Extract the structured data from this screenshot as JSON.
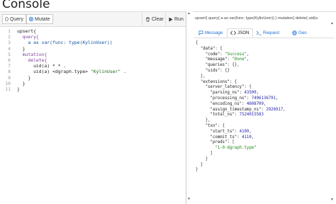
{
  "page": {
    "title": "Console"
  },
  "toolbar": {
    "query_label": "Query",
    "mutate_label": "Mutate",
    "mode_selected": "Mutate",
    "clear_label": "Clear",
    "run_label": "Run"
  },
  "editor": {
    "line_numbers": [
      "1",
      "2",
      "3",
      "4",
      "5",
      "6",
      "7",
      "8",
      "9",
      "10",
      "11"
    ],
    "lines": [
      {
        "parts": [
          {
            "t": "upsert{",
            "c": ""
          }
        ]
      },
      {
        "parts": [
          {
            "t": "  query{",
            "c": "kw"
          }
        ]
      },
      {
        "parts": [
          {
            "t": "    a as var(func: type(KylinUser))",
            "c": "fn"
          }
        ]
      },
      {
        "parts": [
          {
            "t": "  }",
            "c": ""
          }
        ]
      },
      {
        "parts": [
          {
            "t": "  mutation{",
            "c": "kw"
          }
        ]
      },
      {
        "parts": [
          {
            "t": "    delete{",
            "c": "kw"
          }
        ]
      },
      {
        "parts": [
          {
            "t": "      uid(a) * * .",
            "c": ""
          }
        ]
      },
      {
        "parts": [
          {
            "t": "      uid(a) <dgraph.type> ",
            "c": ""
          },
          {
            "t": "\"KylinUser\"",
            "c": "str"
          },
          {
            "t": " .",
            "c": ""
          }
        ]
      },
      {
        "parts": [
          {
            "t": "    }",
            "c": ""
          }
        ]
      },
      {
        "parts": [
          {
            "t": "  }",
            "c": ""
          }
        ]
      },
      {
        "parts": [
          {
            "t": "}",
            "c": ""
          }
        ]
      }
    ]
  },
  "query_summary": "upsert{ query{ a as var(func: type(KylinUser)) } mutation{ delete{ uid(a",
  "tabs": [
    {
      "label": "Message",
      "icon": "message-icon",
      "active": false
    },
    {
      "label": "JSON",
      "icon": "code-icon",
      "active": true
    },
    {
      "label": "Request",
      "icon": "terminal-icon",
      "active": false
    },
    {
      "label": "Geo",
      "icon": "globe-icon",
      "active": false
    }
  ],
  "json_lines": [
    [
      {
        "t": "{",
        "c": ""
      }
    ],
    [
      {
        "t": "  \"data\"",
        "c": "jk"
      },
      {
        "t": ": {",
        "c": ""
      }
    ],
    [
      {
        "t": "    \"code\"",
        "c": "jk"
      },
      {
        "t": ": ",
        "c": ""
      },
      {
        "t": "\"Success\"",
        "c": "js"
      },
      {
        "t": ",",
        "c": ""
      }
    ],
    [
      {
        "t": "    \"message\"",
        "c": "jk"
      },
      {
        "t": ": ",
        "c": ""
      },
      {
        "t": "\"Done\"",
        "c": "js"
      },
      {
        "t": ",",
        "c": ""
      }
    ],
    [
      {
        "t": "    \"queries\"",
        "c": "jk"
      },
      {
        "t": ": {},",
        "c": ""
      }
    ],
    [
      {
        "t": "    \"uids\"",
        "c": "jk"
      },
      {
        "t": ": {}",
        "c": ""
      }
    ],
    [
      {
        "t": "  },",
        "c": ""
      }
    ],
    [
      {
        "t": "  \"extensions\"",
        "c": "jk"
      },
      {
        "t": ": {",
        "c": ""
      }
    ],
    [
      {
        "t": "    \"server_latency\"",
        "c": "jk"
      },
      {
        "t": ": {",
        "c": ""
      }
    ],
    [
      {
        "t": "      \"parsing_ns\"",
        "c": "jk"
      },
      {
        "t": ": ",
        "c": ""
      },
      {
        "t": "43500",
        "c": "jn"
      },
      {
        "t": ",",
        "c": ""
      }
    ],
    [
      {
        "t": "      \"processing_ns\"",
        "c": "jk"
      },
      {
        "t": ": ",
        "c": ""
      },
      {
        "t": "7496136791",
        "c": "jn"
      },
      {
        "t": ",",
        "c": ""
      }
    ],
    [
      {
        "t": "      \"encoding_ns\"",
        "c": "jk"
      },
      {
        "t": ": ",
        "c": ""
      },
      {
        "t": "4608709",
        "c": "jn"
      },
      {
        "t": ",",
        "c": ""
      }
    ],
    [
      {
        "t": "      \"assign_timestamp_ns\"",
        "c": "jk"
      },
      {
        "t": ": ",
        "c": ""
      },
      {
        "t": "2926917",
        "c": "jn"
      },
      {
        "t": ",",
        "c": ""
      }
    ],
    [
      {
        "t": "      \"total_ns\"",
        "c": "jk"
      },
      {
        "t": ": ",
        "c": ""
      },
      {
        "t": "7524015583",
        "c": "jn"
      }
    ],
    [
      {
        "t": "    },",
        "c": ""
      }
    ],
    [
      {
        "t": "    \"txn\"",
        "c": "jk"
      },
      {
        "t": ": {",
        "c": ""
      }
    ],
    [
      {
        "t": "      \"start_ts\"",
        "c": "jk"
      },
      {
        "t": ": ",
        "c": ""
      },
      {
        "t": "4109",
        "c": "jn"
      },
      {
        "t": ",",
        "c": ""
      }
    ],
    [
      {
        "t": "      \"commit_ts\"",
        "c": "jk"
      },
      {
        "t": ": ",
        "c": ""
      },
      {
        "t": "4110",
        "c": "jn"
      },
      {
        "t": ",",
        "c": ""
      }
    ],
    [
      {
        "t": "      \"preds\"",
        "c": "jk"
      },
      {
        "t": ": [",
        "c": ""
      }
    ],
    [
      {
        "t": "        \"1-0-dgraph.type\"",
        "c": "js"
      }
    ],
    [
      {
        "t": "      ]",
        "c": ""
      }
    ],
    [
      {
        "t": "    }",
        "c": ""
      }
    ],
    [
      {
        "t": "  }",
        "c": ""
      }
    ],
    [
      {
        "t": "}",
        "c": ""
      }
    ]
  ],
  "colors": {
    "accent": "#1e6fd9",
    "string": "#1a8a1a",
    "number": "#1c1caa"
  }
}
